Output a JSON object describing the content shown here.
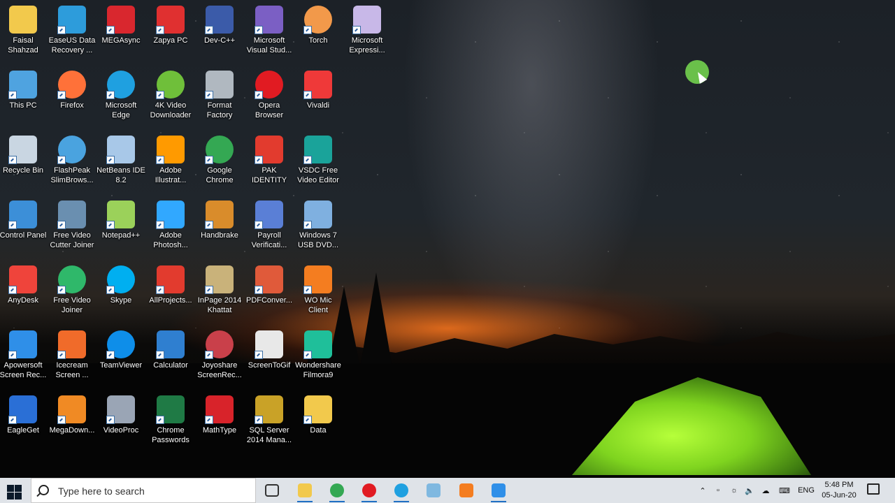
{
  "desktop": {
    "icons": [
      {
        "label": "Faisal Shahzad",
        "icon": "user-folder-icon",
        "color": "#f2c94c"
      },
      {
        "label": "EaseUS Data Recovery ...",
        "icon": "easeus-icon",
        "color": "#2d9cdb"
      },
      {
        "label": "MEGAsync",
        "icon": "mega-icon",
        "color": "#d9272e"
      },
      {
        "label": "Zapya PC",
        "icon": "zapya-icon",
        "color": "#e03030"
      },
      {
        "label": "Dev-C++",
        "icon": "devcpp-icon",
        "color": "#3b5ba9"
      },
      {
        "label": "Microsoft Visual Stud...",
        "icon": "visual-studio-icon",
        "color": "#7b5fc4"
      },
      {
        "label": "Torch",
        "icon": "torch-icon",
        "color": "#f2994a"
      },
      {
        "label": "Microsoft Expressi...",
        "icon": "expression-icon",
        "color": "#c8b8e8"
      },
      {
        "label": "This PC",
        "icon": "computer-icon",
        "color": "#4fa3e0"
      },
      {
        "label": "Firefox",
        "icon": "firefox-icon",
        "color": "#ff7139"
      },
      {
        "label": "Microsoft Edge",
        "icon": "edge-icon",
        "color": "#1fa0e0"
      },
      {
        "label": "4K Video Downloader",
        "icon": "4k-downloader-icon",
        "color": "#6fbf3a"
      },
      {
        "label": "Format Factory",
        "icon": "format-factory-icon",
        "color": "#b0b8c0"
      },
      {
        "label": "Opera Browser",
        "icon": "opera-icon",
        "color": "#e11b22"
      },
      {
        "label": "Vivaldi",
        "icon": "vivaldi-icon",
        "color": "#ef3939"
      },
      {
        "label": "Recycle Bin",
        "icon": "recycle-bin-icon",
        "color": "#c9d6e2"
      },
      {
        "label": "FlashPeak SlimBrows...",
        "icon": "slimbrowser-icon",
        "color": "#4aa3df"
      },
      {
        "label": "NetBeans IDE 8.2",
        "icon": "netbeans-icon",
        "color": "#a8c8e8"
      },
      {
        "label": "Adobe Illustrat...",
        "icon": "illustrator-icon",
        "color": "#ff9a00"
      },
      {
        "label": "Google Chrome",
        "icon": "chrome-icon",
        "color": "#34a853"
      },
      {
        "label": "PAK IDENTITY",
        "icon": "pdf-icon",
        "color": "#e23b2e"
      },
      {
        "label": "VSDC Free Video Editor",
        "icon": "vsdc-icon",
        "color": "#1aa39a"
      },
      {
        "label": "Control Panel",
        "icon": "control-panel-icon",
        "color": "#3c8fd8"
      },
      {
        "label": "Free Video Cutter Joiner",
        "icon": "video-cutter-icon",
        "color": "#6a8fb0"
      },
      {
        "label": "Notepad++",
        "icon": "notepad-plus-icon",
        "color": "#9bd15a"
      },
      {
        "label": "Adobe Photosh...",
        "icon": "photoshop-icon",
        "color": "#31a8ff"
      },
      {
        "label": "Handbrake",
        "icon": "handbrake-icon",
        "color": "#d98c2b"
      },
      {
        "label": "Payroll Verificati...",
        "icon": "payroll-icon",
        "color": "#5a7fd6"
      },
      {
        "label": "Windows 7 USB DVD...",
        "icon": "win7-usb-icon",
        "color": "#7fb0e0"
      },
      {
        "label": "AnyDesk",
        "icon": "anydesk-icon",
        "color": "#ef443b"
      },
      {
        "label": "Free Video Joiner",
        "icon": "video-joiner-icon",
        "color": "#2fb86a"
      },
      {
        "label": "Skype",
        "icon": "skype-icon",
        "color": "#00aff0"
      },
      {
        "label": "AllProjects...",
        "icon": "pdf-icon",
        "color": "#e23b2e"
      },
      {
        "label": "InPage 2014 Khattat",
        "icon": "inpage-icon",
        "color": "#c9b27a"
      },
      {
        "label": "PDFConver...",
        "icon": "pdf-converter-icon",
        "color": "#e05a3a"
      },
      {
        "label": "WO Mic Client",
        "icon": "microphone-icon",
        "color": "#f47d20"
      },
      {
        "label": "Apowersoft Screen Rec...",
        "icon": "apowersoft-icon",
        "color": "#2f8fe8"
      },
      {
        "label": "Icecream Screen ...",
        "icon": "icecream-icon",
        "color": "#f06b2a"
      },
      {
        "label": "TeamViewer",
        "icon": "teamviewer-icon",
        "color": "#0e8ee9"
      },
      {
        "label": "Calculator",
        "icon": "calculator-icon",
        "color": "#2f7fd0"
      },
      {
        "label": "Joyoshare ScreenRec...",
        "icon": "joyoshare-icon",
        "color": "#c9404a"
      },
      {
        "label": "ScreenToGif",
        "icon": "screentogif-icon",
        "color": "#e8e8e8"
      },
      {
        "label": "Wondershare Filmora9",
        "icon": "filmora-icon",
        "color": "#1fbf9a"
      },
      {
        "label": "EagleGet",
        "icon": "eagleget-icon",
        "color": "#2a6fd6"
      },
      {
        "label": "MegaDown...",
        "icon": "megadownloader-icon",
        "color": "#f08a24"
      },
      {
        "label": "VideoProc",
        "icon": "videoproc-icon",
        "color": "#9aa5b5"
      },
      {
        "label": "Chrome Passwords",
        "icon": "excel-icon",
        "color": "#1f7a45"
      },
      {
        "label": "MathType",
        "icon": "mathtype-icon",
        "color": "#d8232a"
      },
      {
        "label": "SQL Server 2014 Mana...",
        "icon": "sql-server-icon",
        "color": "#c9a227"
      },
      {
        "label": "Data",
        "icon": "folder-icon",
        "color": "#f2c94c"
      }
    ]
  },
  "taskbar": {
    "search_placeholder": "Type here to search",
    "pinned": [
      {
        "name": "task-view-icon",
        "color": "#333333"
      },
      {
        "name": "file-explorer-icon",
        "color": "#f2c94c"
      },
      {
        "name": "chrome-icon",
        "color": "#34a853"
      },
      {
        "name": "opera-icon",
        "color": "#e11b22"
      },
      {
        "name": "edge-icon",
        "color": "#1fa0e0"
      },
      {
        "name": "notes-icon",
        "color": "#7fb8e0"
      },
      {
        "name": "microphone-icon",
        "color": "#f47d20"
      },
      {
        "name": "screen-recorder-icon",
        "color": "#2f8fe8"
      }
    ],
    "tray": {
      "language": "ENG",
      "time": "5:48 PM",
      "date": "05-Jun-20"
    }
  }
}
